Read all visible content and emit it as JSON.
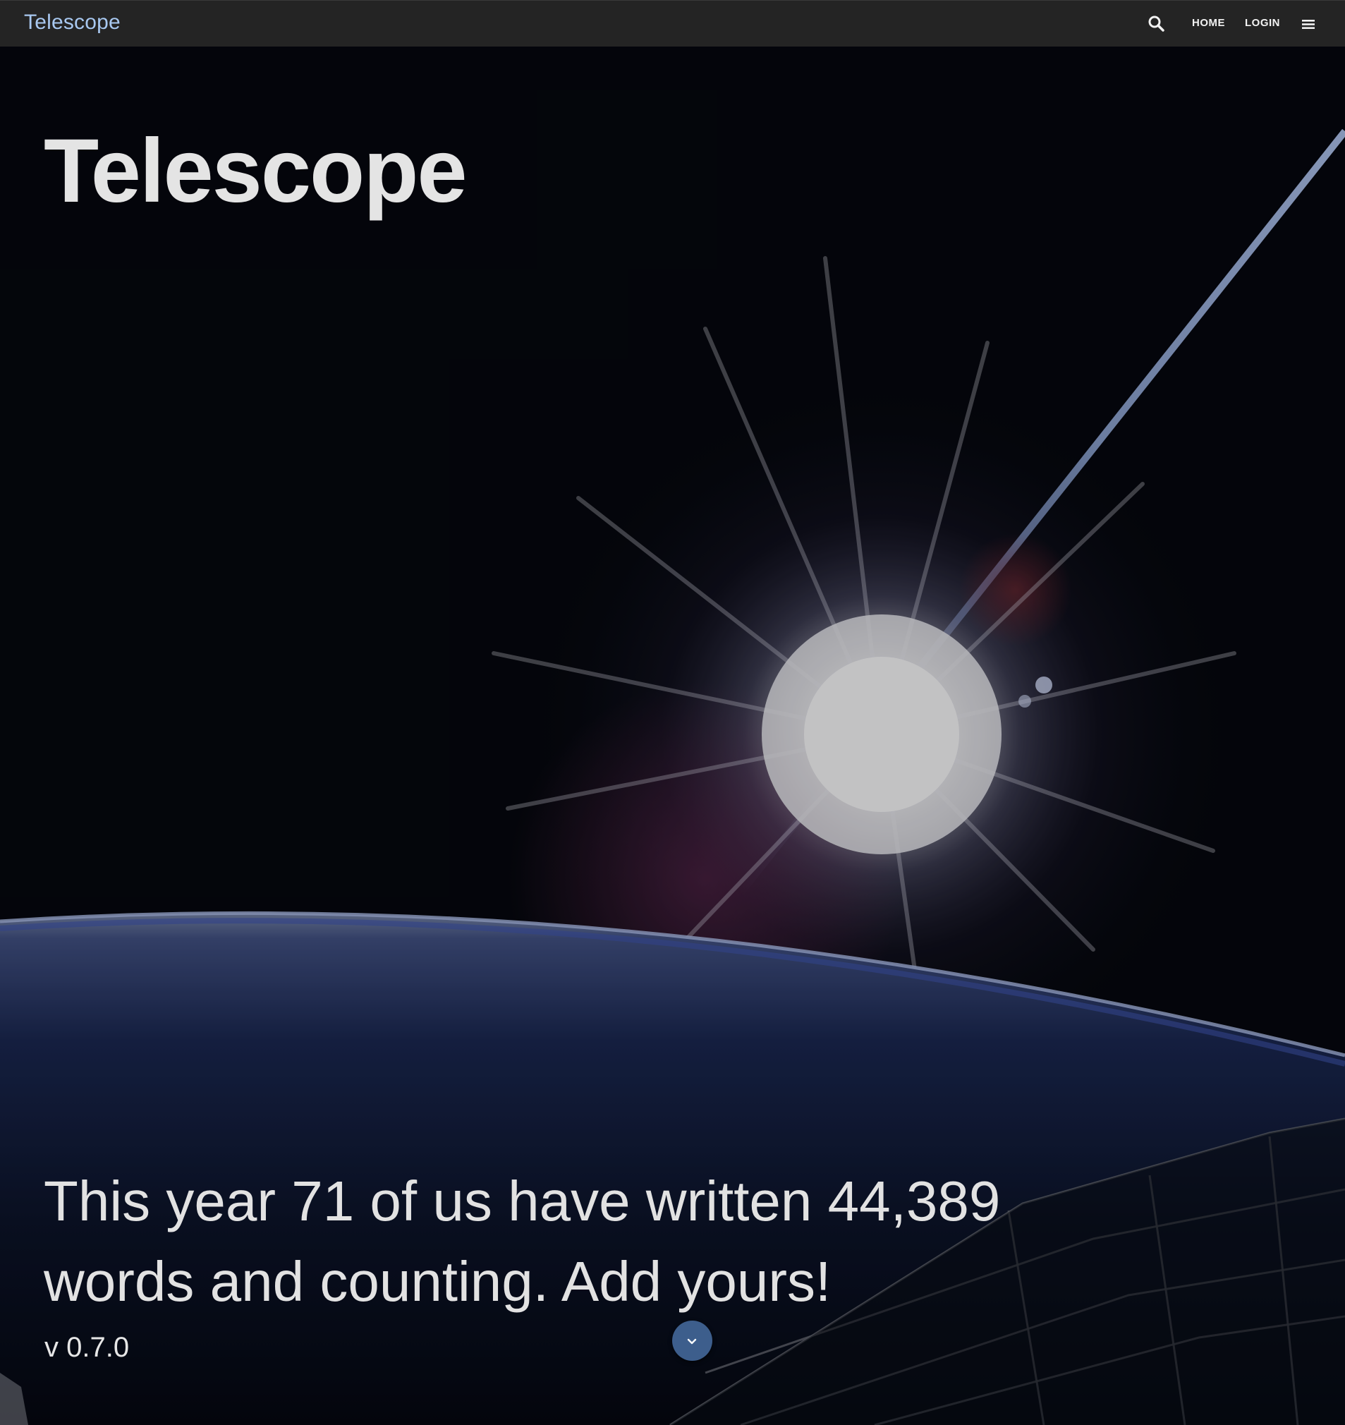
{
  "topbar": {
    "brand": "Telescope",
    "nav": {
      "search_icon": "search-icon",
      "home_label": "HOME",
      "login_label": "LOGIN",
      "menu_icon": "menu-icon"
    }
  },
  "hero": {
    "title": "Telescope",
    "tagline": "This year 71 of us have written 44,389 words and counting. Add yours!",
    "version": "v 0.7.0",
    "scroll_icon": "chevron-down-icon"
  },
  "colors": {
    "topbar_bg": "#242424",
    "brand": "#a8c8f0",
    "scroll_button": "#3d5e8c"
  }
}
